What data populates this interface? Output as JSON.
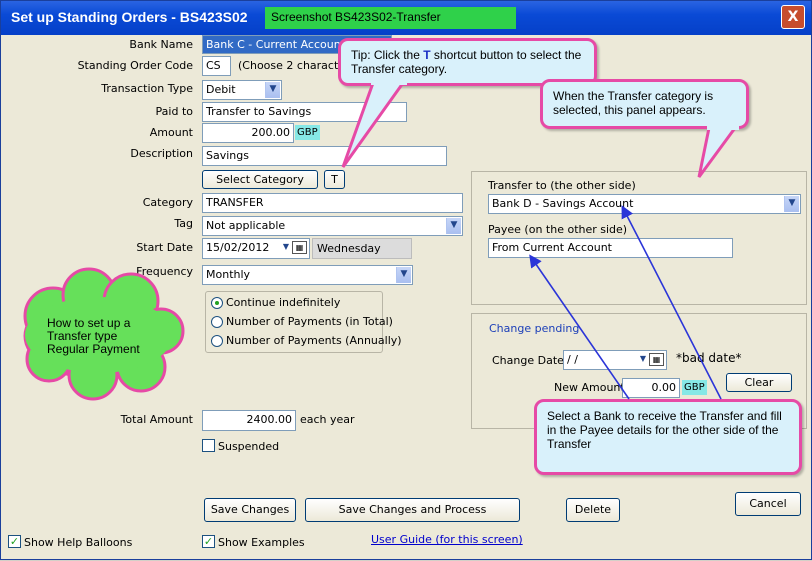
{
  "window": {
    "title": "Set up Standing Orders - BS423S02",
    "screenshot_label": "Screenshot BS423S02-Transfer",
    "close_label": "X"
  },
  "form": {
    "bank_name_label": "Bank Name",
    "bank_name_value": "Bank C - Current Account",
    "code_label": "Standing Order Code",
    "code_value": "CS",
    "code_hint": "(Choose 2 characte",
    "txn_type_label": "Transaction Type",
    "txn_type_value": "Debit",
    "paid_to_label": "Paid to",
    "paid_to_value": "Transfer to Savings",
    "amount_label": "Amount",
    "amount_value": "200.00",
    "currency": "GBP",
    "description_label": "Description",
    "description_value": "Savings",
    "select_category_button": "Select Category",
    "shortcut_t_button": "T",
    "category_label": "Category",
    "category_value": "TRANSFER",
    "tag_label": "Tag",
    "tag_value": "Not applicable",
    "start_date_label": "Start Date",
    "start_date_value": "15/02/2012",
    "start_day_value": "Wednesday",
    "frequency_label": "Frequency",
    "frequency_value": "Monthly",
    "radio_continue": "Continue indefinitely",
    "radio_payments_total": "Number of Payments (in Total)",
    "radio_payments_annual": "Number of Payments (Annually)",
    "total_amount_label": "Total Amount",
    "total_amount_value": "2400.00",
    "total_amount_suffix": "each year",
    "suspended_label": "Suspended"
  },
  "transfer_panel": {
    "transfer_to_label": "Transfer to (the other side)",
    "transfer_to_value": "Bank D - Savings Account",
    "payee_label": "Payee (on the other side)",
    "payee_value": "From Current Account"
  },
  "change_panel": {
    "title": "Change pending",
    "change_date_label": "Change Date",
    "change_date_value": " / /",
    "bad_date_text": "*bad date*",
    "new_amount_label": "New Amount",
    "new_amount_value": "0.00",
    "currency": "GBP",
    "clear_button": "Clear"
  },
  "buttons": {
    "save_changes": "Save Changes",
    "save_and_process": "Save Changes and Process",
    "delete": "Delete",
    "cancel": "Cancel"
  },
  "footer": {
    "show_help_balloons": "Show Help Balloons",
    "show_examples": "Show Examples",
    "user_guide_link": "User Guide (for this screen)"
  },
  "balloons": {
    "tip_prefix": "Tip:  Click the ",
    "tip_t": "T",
    "tip_suffix": " shortcut button to select the Transfer category.",
    "panel_note": "When the Transfer category is selected, this panel appears.",
    "cloud_note": "How to set up a Transfer type Regular Payment",
    "bank_note": "Select a Bank to receive the Transfer and fill in the Payee details for the other side of the Transfer"
  },
  "colors": {
    "balloon_border": "#e64aa6",
    "balloon_fill": "#d9f1fb",
    "cloud_fill": "#66e05a",
    "arrow": "#2b35d8"
  },
  "icons": [
    "close-icon",
    "chevron-down-icon",
    "calendar-icon"
  ]
}
